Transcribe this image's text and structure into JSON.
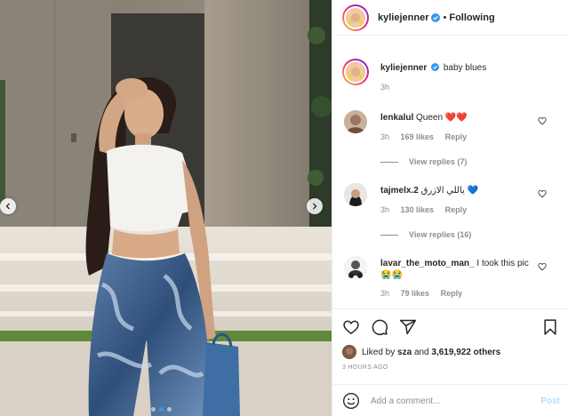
{
  "post": {
    "author": "kyliejenner",
    "follow_separator": "•",
    "follow_state": "Following",
    "caption": "baby blues",
    "caption_time": "3h"
  },
  "comments": [
    {
      "username": "lenkalul",
      "text": "Queen ❤️❤️",
      "time": "3h",
      "likes": "169 likes",
      "reply": "Reply",
      "view_replies": "View replies (7)"
    },
    {
      "username": "tajmelx.2",
      "text": "ياللي الازرق 💙",
      "time": "3h",
      "likes": "130 likes",
      "reply": "Reply",
      "view_replies": "View replies (16)"
    },
    {
      "username": "lavar_the_moto_man_",
      "text": "I took this pic 😭😭",
      "time": "3h",
      "likes": "79 likes",
      "reply": "Reply"
    }
  ],
  "actions": {
    "icons": [
      "heart-icon",
      "comment-icon",
      "share-icon",
      "bookmark-icon"
    ],
    "likes_prefix": "Liked by",
    "likes_user": "sza",
    "likes_and": "and",
    "likes_count": "3,619,922 others",
    "timestamp": "3 HOURS AGO",
    "comment_placeholder": "Add a comment...",
    "post_label": "Post"
  },
  "carousel": {
    "slides": 3,
    "active": 1
  },
  "colors": {
    "verified": "#3897f0",
    "heart": "#ed4956",
    "post_disabled": "#b2dffc",
    "muted": "#8e8e8e"
  }
}
